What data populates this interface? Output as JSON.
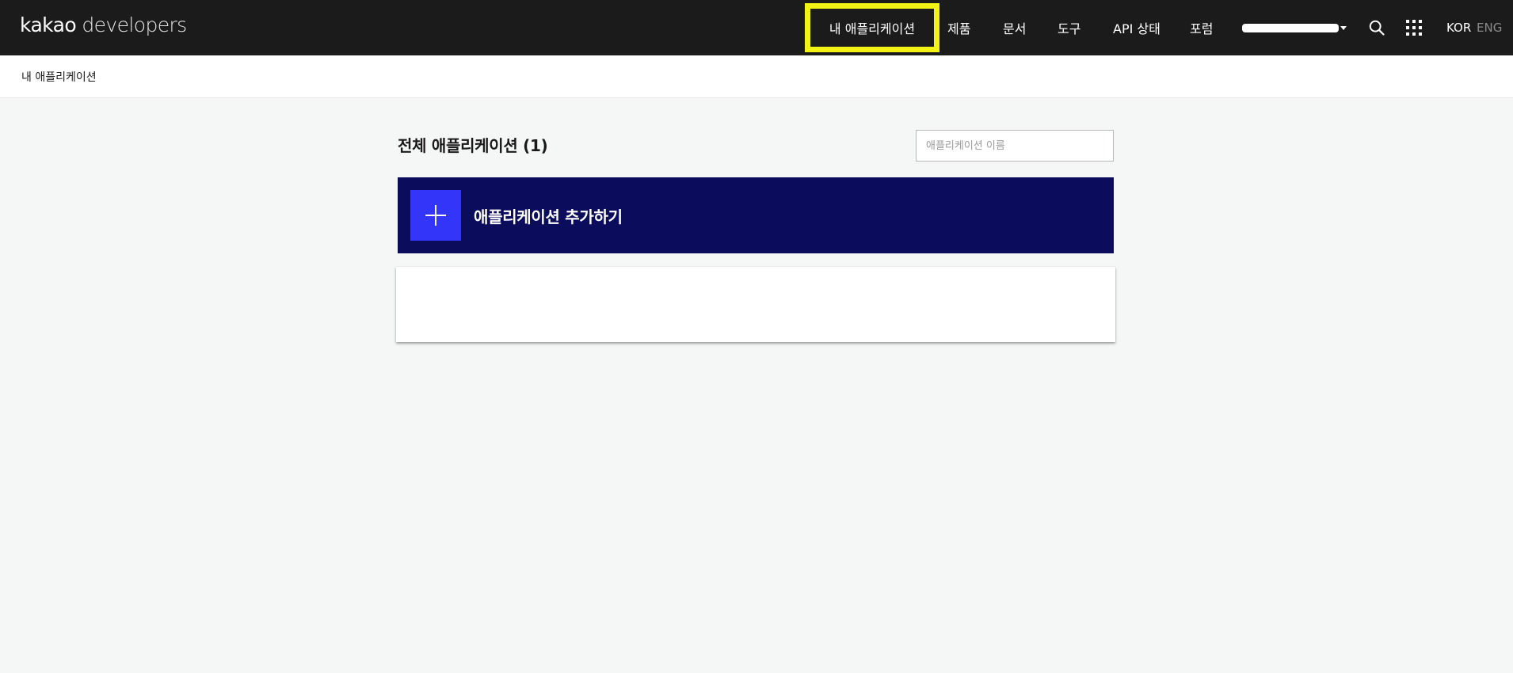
{
  "header": {
    "logo": {
      "part1": "kakao",
      "part2": "developers"
    },
    "nav": {
      "my_apps": "내 애플리케이션",
      "products": "제품",
      "docs": "문서",
      "tools": "도구",
      "api_status": "API 상태",
      "forum": "포럼"
    },
    "icons": {
      "search": "search-icon",
      "apps_grid": "grid-icon"
    },
    "lang": {
      "kor": "KOR",
      "eng": "ENG",
      "active": "KOR"
    }
  },
  "breadcrumb": {
    "current": "내 애플리케이션"
  },
  "main": {
    "title": "전체 애플리케이션 (1)",
    "search": {
      "placeholder": "애플리케이션 이름",
      "value": ""
    },
    "add_app": {
      "label": "애플리케이션 추가하기",
      "icon": "plus-icon"
    }
  },
  "colors": {
    "header_bg": "#1b1b1b",
    "highlight": "#f2f215",
    "add_app_bg": "#0c0c5c",
    "plus_box": "#3336f8",
    "page_bg": "#f5f6f6"
  }
}
